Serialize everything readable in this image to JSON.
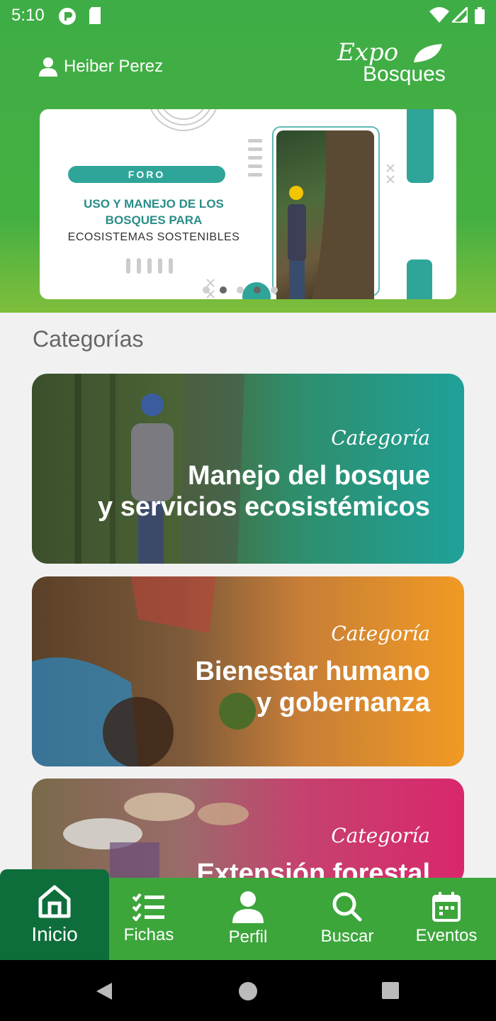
{
  "status": {
    "time": "5:10"
  },
  "header": {
    "user_name": "Heiber Perez",
    "logo_line1": "Expo",
    "logo_line2": "Bosques"
  },
  "banner": {
    "pill": "FORO",
    "title": "USO Y MANEJO DE LOS BOSQUES PARA",
    "subtitle": "ECOSISTEMAS SOSTENIBLES"
  },
  "categories": {
    "title": "Categorías",
    "items": [
      {
        "label": "Categoría",
        "name_l1": "Manejo del bosque",
        "name_l2": "y servicios ecosistémicos",
        "color": "#1fa19a"
      },
      {
        "label": "Categoría",
        "name_l1": "Bienestar humano",
        "name_l2": "y gobernanza",
        "color": "#f19a24"
      },
      {
        "label": "Categoría",
        "name_l1": "Extensión forestal",
        "name_l2": "",
        "color": "#d9276c"
      }
    ]
  },
  "nav": {
    "items": [
      {
        "label": "Inicio",
        "icon": "home-icon"
      },
      {
        "label": "Fichas",
        "icon": "checklist-icon"
      },
      {
        "label": "Perfil",
        "icon": "person-icon"
      },
      {
        "label": "Buscar",
        "icon": "search-icon"
      },
      {
        "label": "Eventos",
        "icon": "calendar-icon"
      }
    ]
  },
  "colors": {
    "primary_green": "#3ca63b",
    "active_nav": "#0e6e3b",
    "teal": "#2fa59a"
  }
}
